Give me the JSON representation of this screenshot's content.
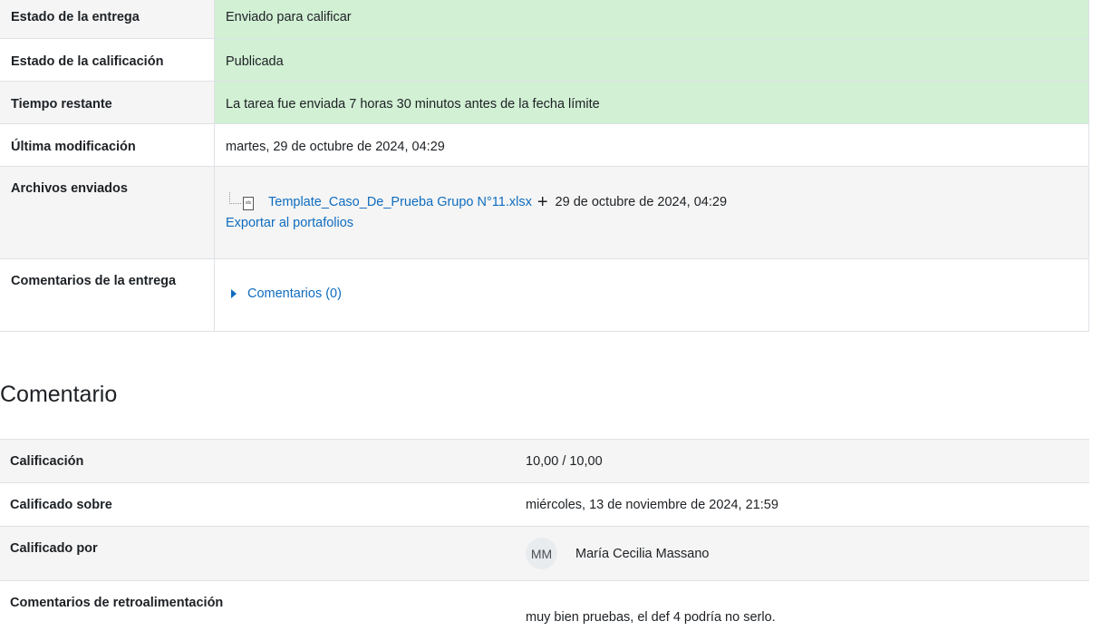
{
  "submission": {
    "rows": [
      {
        "label": "Estado de la entrega",
        "value": "Enviado para calificar"
      },
      {
        "label": "Estado de la calificación",
        "value": "Publicada"
      },
      {
        "label": "Tiempo restante",
        "value": "La tarea fue enviada 7 horas 30 minutos antes de la fecha límite"
      },
      {
        "label": "Última modificación",
        "value": "martes, 29 de octubre de 2024, 04:29"
      }
    ],
    "files": {
      "label": "Archivos enviados",
      "file_name": "Template_Caso_De_Prueba Grupo N°11.xlsx",
      "plus_icon": "+",
      "file_date": "29 de octubre de 2024, 04:29",
      "export_link": "Exportar al portafolios"
    },
    "comments": {
      "label": "Comentarios de la entrega",
      "toggle": "Comentarios (0)"
    },
    "green_color": "#d2f0d4",
    "link_color": "#0f6cbf"
  },
  "feedback": {
    "title": "Comentario",
    "grade_label": "Calificación",
    "grade_value": "10,00 / 10,00",
    "graded_on_label": "Calificado sobre",
    "graded_on_value": "miércoles, 13 de noviembre de 2024, 21:59",
    "graded_by_label": "Calificado por",
    "grader_initials": "MM",
    "grader_name": "María Cecilia Massano",
    "feedback_comments_label": "Comentarios de retroalimentación",
    "feedback_comments_value": "muy bien pruebas, el def 4 podría no serlo."
  }
}
